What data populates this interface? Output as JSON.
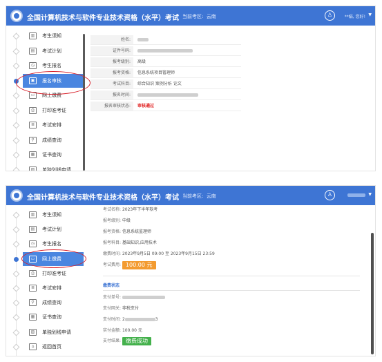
{
  "header": {
    "title": "全国计算机技术与软件专业技术资格（水平）考试",
    "area_label": "当前考区:",
    "area_value": "云南",
    "user_name": "**娟, 您好!",
    "user_caret": "▼",
    "user_icon": "user-icon"
  },
  "sidebar1": [
    {
      "label": "考生须知",
      "icon": "building-icon",
      "glyph": "▥"
    },
    {
      "label": "考试计划",
      "icon": "calendar-icon",
      "glyph": "▤"
    },
    {
      "label": "考生报名",
      "icon": "clock-icon",
      "glyph": "◷"
    },
    {
      "label": "报名审核",
      "icon": "document-icon",
      "glyph": "▣",
      "active": true
    },
    {
      "label": "网上缴费",
      "icon": "monitor-icon",
      "glyph": "▭"
    },
    {
      "label": "打印准考证",
      "icon": "printer-icon",
      "glyph": "⎙"
    },
    {
      "label": "考试安排",
      "icon": "notes-icon",
      "glyph": "≣"
    },
    {
      "label": "成绩查询",
      "icon": "search-icon",
      "glyph": "⚲"
    },
    {
      "label": "证书查询",
      "icon": "certificate-icon",
      "glyph": "▦"
    },
    {
      "label": "单独划线申请",
      "icon": "image-icon",
      "glyph": "▨"
    }
  ],
  "review": {
    "rows": [
      {
        "k": "姓名:",
        "v": "",
        "blur": 16
      },
      {
        "k": "证件号码:",
        "v": "",
        "blur": 80
      },
      {
        "k": "报考级别:",
        "v": "高级"
      },
      {
        "k": "报考资格:",
        "v": "信息系统项目管理师"
      },
      {
        "k": "考试科目:",
        "v": "综合知识 案例分析 论文"
      },
      {
        "k": "报名时间:",
        "v": "",
        "blur": 88
      },
      {
        "k": "报名审核状态:",
        "v": "审核通过",
        "red": true
      }
    ]
  },
  "sidebar2": [
    {
      "label": "考生须知",
      "icon": "building-icon",
      "glyph": "▥"
    },
    {
      "label": "考试计划",
      "icon": "calendar-icon",
      "glyph": "▤"
    },
    {
      "label": "考生报名",
      "icon": "clock-icon",
      "glyph": "◷"
    },
    {
      "label": "网上缴费",
      "icon": "monitor-icon",
      "glyph": "▭",
      "active": true
    },
    {
      "label": "打印准考证",
      "icon": "printer-icon",
      "glyph": "⎙"
    },
    {
      "label": "考试安排",
      "icon": "notes-icon",
      "glyph": "≣"
    },
    {
      "label": "成绩查询",
      "icon": "search-icon",
      "glyph": "⚲"
    },
    {
      "label": "证书查询",
      "icon": "certificate-icon",
      "glyph": "▦"
    },
    {
      "label": "单独划线申请",
      "icon": "image-icon",
      "glyph": "▨"
    },
    {
      "label": "返回首页",
      "icon": "home-icon",
      "glyph": "⌂"
    }
  ],
  "payment": {
    "exam_name_k": "考试名称:",
    "exam_name_v": "2023年下半年软考",
    "level_k": "报考级别:",
    "level_v": "中级",
    "qual_k": "报考资格:",
    "qual_v": "信息系统监理师",
    "subject_k": "报考科目:",
    "subject_v": "基础知识,应用技术",
    "period_k": "缴费时间:",
    "period_v": "2023年9月5日 09:00 至 2023年9月15日 23:59",
    "fee_k": "考试费用:",
    "fee_v": "100.00 元",
    "status_title": "缴费状态",
    "order_k": "支付单号:",
    "gateway_k": "支付网关:",
    "gateway_v": "非税支付",
    "time_k": "支付时间:",
    "time_v": "2",
    "time_tail": "3",
    "amount_k": "实付金额:",
    "amount_v": "100.00 元",
    "result_k": "支付结果:",
    "result_v": "缴费成功"
  }
}
